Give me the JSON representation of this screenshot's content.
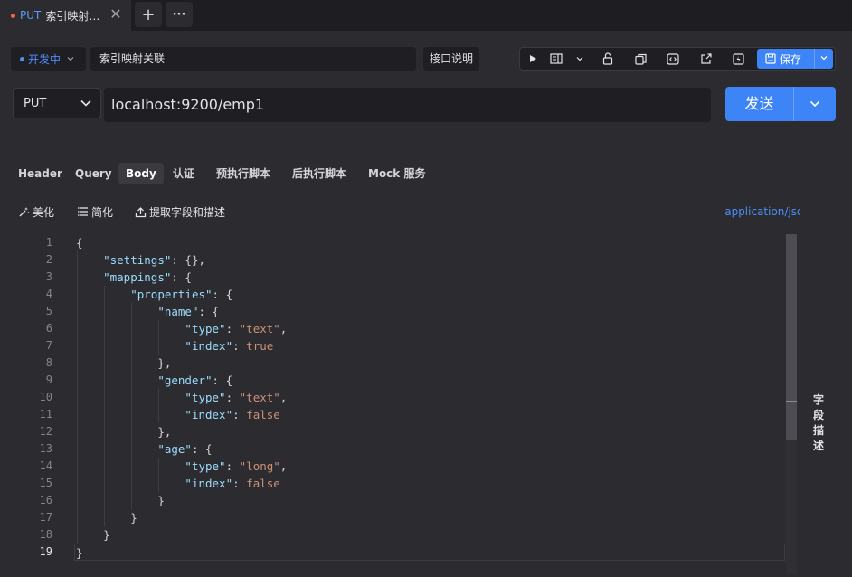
{
  "tab": {
    "method": "PUT",
    "title": "索引映射…",
    "close": "✕",
    "add": "+",
    "more": "···"
  },
  "header": {
    "env": "开发中",
    "name": "索引映射关联",
    "doc_label": "接口说明",
    "save_label": "保存"
  },
  "request": {
    "method": "PUT",
    "url": "localhost:9200/emp1",
    "send_label": "发送"
  },
  "tabs": [
    "Header",
    "Query",
    "Body",
    "认证",
    "预执行脚本",
    "后执行脚本",
    "Mock 服务"
  ],
  "actions": {
    "beautify": "美化",
    "simplify": "简化",
    "extract": "提取字段和描述",
    "content_type": "application/json"
  },
  "side_label": "字段描述",
  "colors": {
    "accent": "#3d84f6",
    "key": "#9cdcfe",
    "string": "#ce9178",
    "tab_dot": "#f06a3a"
  },
  "code_lines": [
    {
      "n": "1",
      "i": 0,
      "parts": [
        {
          "t": "{",
          "c": "p"
        }
      ]
    },
    {
      "n": "2",
      "i": 1,
      "parts": [
        {
          "t": "\"settings\"",
          "c": "k"
        },
        {
          "t": ": {},",
          "c": "p"
        }
      ]
    },
    {
      "n": "3",
      "i": 1,
      "parts": [
        {
          "t": "\"mappings\"",
          "c": "k"
        },
        {
          "t": ": {",
          "c": "p"
        }
      ]
    },
    {
      "n": "4",
      "i": 2,
      "parts": [
        {
          "t": "\"properties\"",
          "c": "k"
        },
        {
          "t": ": {",
          "c": "p"
        }
      ]
    },
    {
      "n": "5",
      "i": 3,
      "parts": [
        {
          "t": "\"name\"",
          "c": "k"
        },
        {
          "t": ": {",
          "c": "p"
        }
      ]
    },
    {
      "n": "6",
      "i": 4,
      "parts": [
        {
          "t": "\"type\"",
          "c": "k"
        },
        {
          "t": ": ",
          "c": "p"
        },
        {
          "t": "\"text\"",
          "c": "s"
        },
        {
          "t": ",",
          "c": "p"
        }
      ]
    },
    {
      "n": "7",
      "i": 4,
      "parts": [
        {
          "t": "\"index\"",
          "c": "k"
        },
        {
          "t": ": ",
          "c": "p"
        },
        {
          "t": "true",
          "c": "s"
        }
      ]
    },
    {
      "n": "8",
      "i": 3,
      "parts": [
        {
          "t": "},",
          "c": "p"
        }
      ]
    },
    {
      "n": "9",
      "i": 3,
      "parts": [
        {
          "t": "\"gender\"",
          "c": "k"
        },
        {
          "t": ": {",
          "c": "p"
        }
      ]
    },
    {
      "n": "10",
      "i": 4,
      "parts": [
        {
          "t": "\"type\"",
          "c": "k"
        },
        {
          "t": ": ",
          "c": "p"
        },
        {
          "t": "\"text\"",
          "c": "s"
        },
        {
          "t": ",",
          "c": "p"
        }
      ]
    },
    {
      "n": "11",
      "i": 4,
      "parts": [
        {
          "t": "\"index\"",
          "c": "k"
        },
        {
          "t": ": ",
          "c": "p"
        },
        {
          "t": "false",
          "c": "s"
        }
      ]
    },
    {
      "n": "12",
      "i": 3,
      "parts": [
        {
          "t": "},",
          "c": "p"
        }
      ]
    },
    {
      "n": "13",
      "i": 3,
      "parts": [
        {
          "t": "\"age\"",
          "c": "k"
        },
        {
          "t": ": {",
          "c": "p"
        }
      ]
    },
    {
      "n": "14",
      "i": 4,
      "parts": [
        {
          "t": "\"type\"",
          "c": "k"
        },
        {
          "t": ": ",
          "c": "p"
        },
        {
          "t": "\"long\"",
          "c": "s"
        },
        {
          "t": ",",
          "c": "p"
        }
      ]
    },
    {
      "n": "15",
      "i": 4,
      "parts": [
        {
          "t": "\"index\"",
          "c": "k"
        },
        {
          "t": ": ",
          "c": "p"
        },
        {
          "t": "false",
          "c": "s"
        }
      ]
    },
    {
      "n": "16",
      "i": 3,
      "parts": [
        {
          "t": "}",
          "c": "p"
        }
      ]
    },
    {
      "n": "17",
      "i": 2,
      "parts": [
        {
          "t": "}",
          "c": "p"
        }
      ]
    },
    {
      "n": "18",
      "i": 1,
      "parts": [
        {
          "t": "}",
          "c": "p"
        }
      ]
    },
    {
      "n": "19",
      "i": 0,
      "parts": [
        {
          "t": "}",
          "c": "p"
        }
      ]
    }
  ]
}
